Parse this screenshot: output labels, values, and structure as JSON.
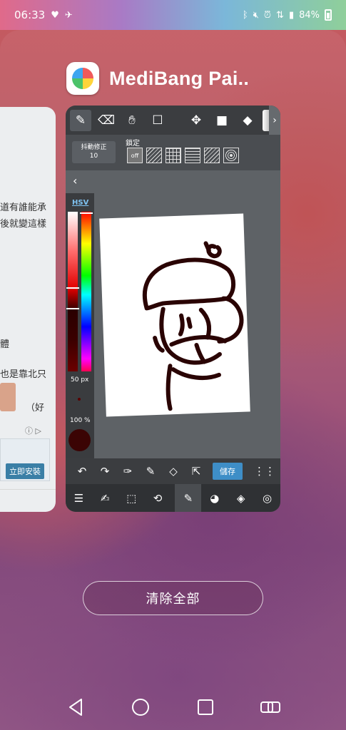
{
  "status": {
    "time": "06:33",
    "battery": "84%",
    "left_icons": [
      "heart-icon",
      "caret-icon"
    ],
    "right_icons": [
      "bluetooth-icon",
      "mute-icon",
      "alarm-icon",
      "wifi-icon",
      "signal-icon",
      "battery-icon"
    ]
  },
  "app": {
    "title": "MediBang Pai.."
  },
  "left_card": {
    "line1": "道有誰能承",
    "line2": "後就變這樣",
    "line3": "體",
    "line4": "也是靠北只",
    "line5": "（好",
    "install_label": "立即安裝"
  },
  "editor": {
    "top_tools": [
      "pen-icon",
      "eraser-icon",
      "hand-icon",
      "select-rect-icon",
      "move-icon",
      "fill-rect-icon",
      "bucket-icon",
      "gradient-icon"
    ],
    "stabilizer_label": "抖動修正",
    "stabilizer_value": "10",
    "lock_label": "鎖定",
    "lock_off": "off",
    "hsv_label": "HSV",
    "brush_size": "50 px",
    "opacity": "100 %",
    "save_label": "儲存",
    "brush_color": "#3b0404"
  },
  "clear_all_label": "清除全部"
}
